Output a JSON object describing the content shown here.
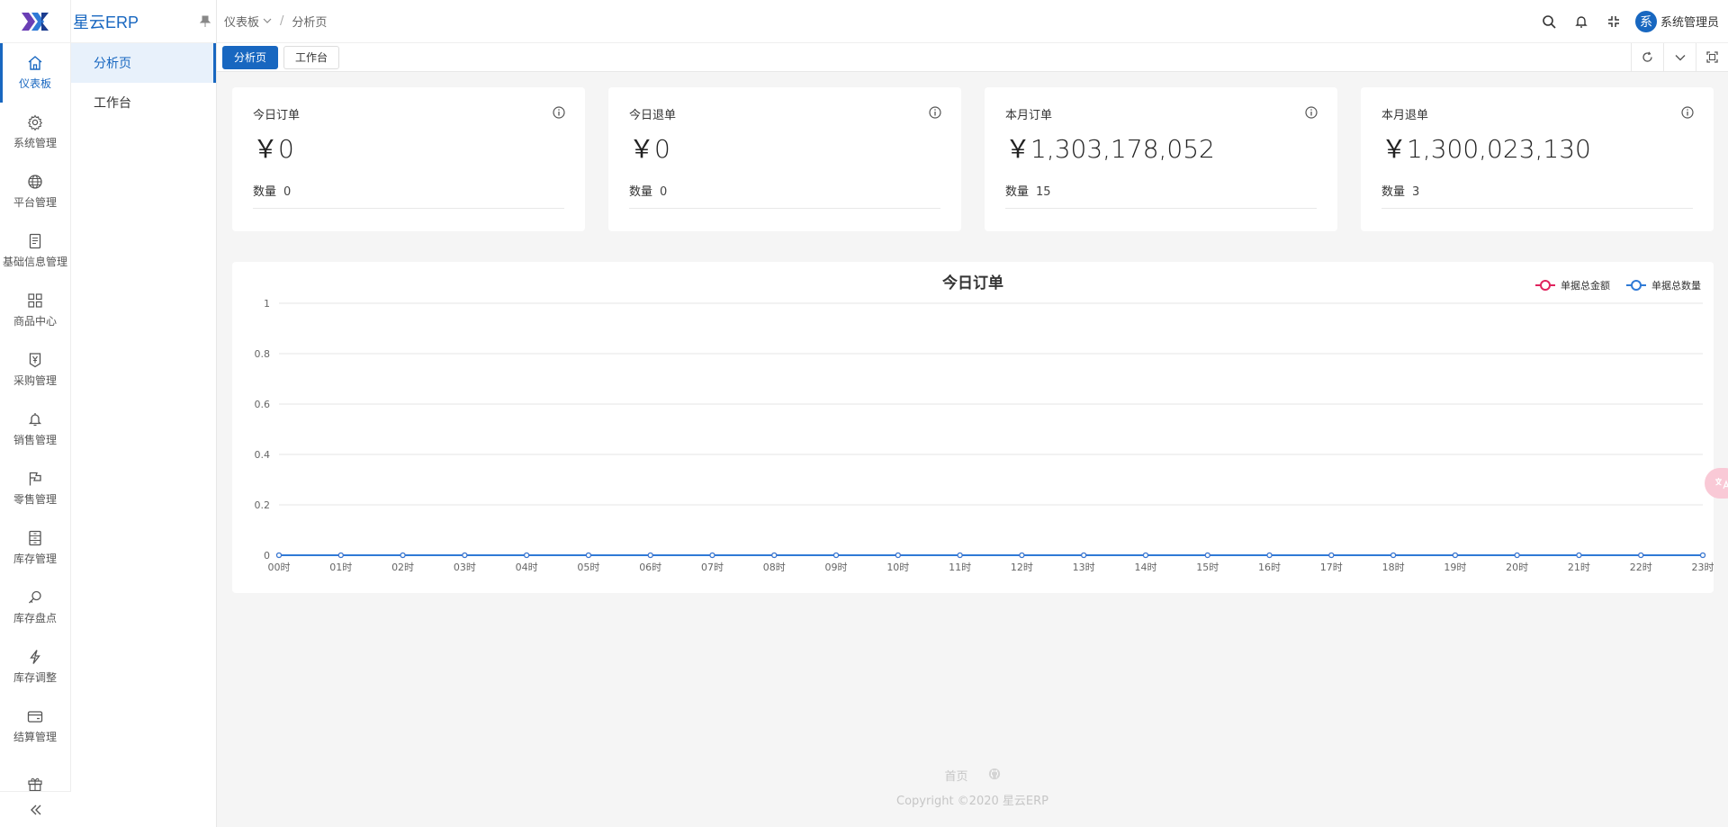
{
  "app": {
    "brand_name": "星云ERP"
  },
  "rail": {
    "items": [
      {
        "label": "仪表板",
        "icon": "home-icon",
        "active": true
      },
      {
        "label": "系统管理",
        "icon": "gear-icon"
      },
      {
        "label": "平台管理",
        "icon": "globe-icon"
      },
      {
        "label": "基础信息管理",
        "icon": "document-icon"
      },
      {
        "label": "商品中心",
        "icon": "grid-icon"
      },
      {
        "label": "采购管理",
        "icon": "yen-tag-icon"
      },
      {
        "label": "销售管理",
        "icon": "bell-icon"
      },
      {
        "label": "零售管理",
        "icon": "flag-icon"
      },
      {
        "label": "库存管理",
        "icon": "archive-icon"
      },
      {
        "label": "库存盘点",
        "icon": "search-key-icon"
      },
      {
        "label": "库存调整",
        "icon": "bolt-icon"
      },
      {
        "label": "结算管理",
        "icon": "wallet-icon"
      },
      {
        "label": "",
        "icon": "gift-icon"
      }
    ]
  },
  "submenu": {
    "items": [
      {
        "label": "分析页",
        "active": true
      },
      {
        "label": "工作台"
      }
    ]
  },
  "header": {
    "breadcrumb": [
      "仪表板",
      "分析页"
    ],
    "user_avatar_char": "系",
    "user_name": "系统管理员"
  },
  "tabs": [
    {
      "label": "分析页",
      "active": true
    },
    {
      "label": "工作台"
    }
  ],
  "cards": [
    {
      "title": "今日订单",
      "value": "￥0",
      "foot_label": "数量",
      "foot_value": "0"
    },
    {
      "title": "今日退单",
      "value": "￥0",
      "foot_label": "数量",
      "foot_value": "0"
    },
    {
      "title": "本月订单",
      "value": "￥1,303,178,052",
      "foot_label": "数量",
      "foot_value": "15"
    },
    {
      "title": "本月退单",
      "value": "￥1,300,023,130",
      "foot_label": "数量",
      "foot_value": "3"
    }
  ],
  "chart_data": {
    "type": "line",
    "title": "今日订单",
    "categories": [
      "00时",
      "01时",
      "02时",
      "03时",
      "04时",
      "05时",
      "06时",
      "07时",
      "08时",
      "09时",
      "10时",
      "11时",
      "12时",
      "13时",
      "14时",
      "15时",
      "16时",
      "17时",
      "18时",
      "19时",
      "20时",
      "21时",
      "22时",
      "23时"
    ],
    "series": [
      {
        "name": "单据总金额",
        "color": "#e0245e",
        "values": [
          0,
          0,
          0,
          0,
          0,
          0,
          0,
          0,
          0,
          0,
          0,
          0,
          0,
          0,
          0,
          0,
          0,
          0,
          0,
          0,
          0,
          0,
          0,
          0
        ]
      },
      {
        "name": "单据总数量",
        "color": "#2f7ad6",
        "values": [
          0,
          0,
          0,
          0,
          0,
          0,
          0,
          0,
          0,
          0,
          0,
          0,
          0,
          0,
          0,
          0,
          0,
          0,
          0,
          0,
          0,
          0,
          0,
          0
        ]
      }
    ],
    "yticks": [
      "0",
      "0.2",
      "0.4",
      "0.6",
      "0.8",
      "1"
    ],
    "ylim": [
      0,
      1
    ],
    "legend": "top-right",
    "grid": true
  },
  "footer": {
    "link_home": "首页",
    "copyright": "Copyright ©2020 星云ERP"
  }
}
